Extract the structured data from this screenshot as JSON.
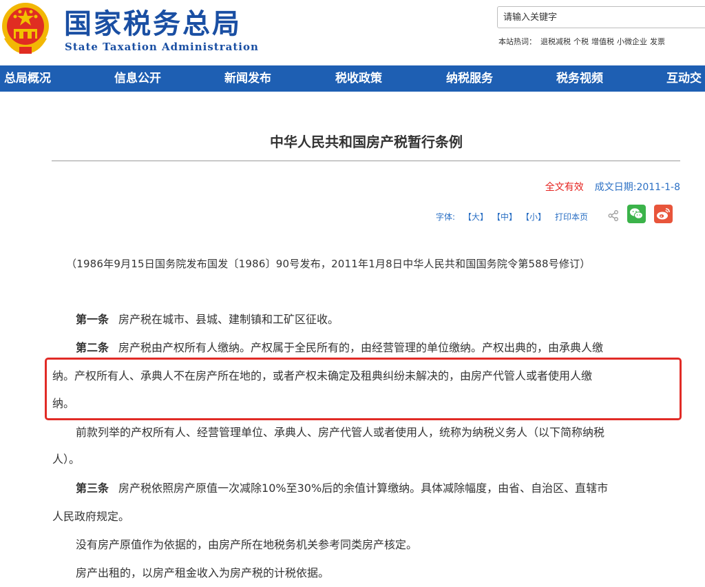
{
  "header": {
    "site_name_cn": "国家税务总局",
    "site_name_en": "State Taxation Administration"
  },
  "search": {
    "placeholder": "请输入关键字"
  },
  "hot_words": {
    "label": "本站热词：",
    "items": [
      "退税减税",
      "个税",
      "增值税",
      "小微企业",
      "发票"
    ]
  },
  "nav": {
    "items": [
      "总局概况",
      "信息公开",
      "新闻发布",
      "税收政策",
      "纳税服务",
      "税务视频",
      "互动交"
    ]
  },
  "article": {
    "title": "中华人民共和国房产税暂行条例",
    "validity": "全文有效",
    "date_label": "成文日期:2011-1-8",
    "font_label": "字体:",
    "font_large": "【大】",
    "font_medium": "【中】",
    "font_small": "【小】",
    "print_label": "打印本页",
    "source": "（1986年9月15日国务院发布国发〔1986〕90号发布，2011年1月8日中华人民共和国国务院令第588号修订）",
    "p1": {
      "no": "第一条",
      "text": "房产税在城市、县城、建制镇和工矿区征收。"
    },
    "p2": {
      "no": "第二条",
      "text": "房产税由产权所有人缴纳。产权属于全民所有的，由经营管理的单位缴纳。产权出典的，由承典人缴"
    },
    "p2_l2": "纳。产权所有人、承典人不在房产所在地的，或者产权未确定及租典纠纷未解决的，由房产代管人或者使用人缴",
    "p2_l3": "纳。",
    "p3_l1": "前款列举的产权所有人、经营管理单位、承典人、房产代管人或者使用人，统称为纳税义务人（以下简称纳税",
    "p3_l2": "人）。",
    "p4": {
      "no": "第三条",
      "text": "房产税依照房产原值一次减除10%至30%后的余值计算缴纳。具体减除幅度，由省、自治区、直辖市"
    },
    "p4_l2": "人民政府规定。",
    "p5": "没有房产原值作为依据的，由房产所在地税务机关参考同类房产核定。",
    "p6": "房产出租的，以房产租金收入为房产税的计税依据。"
  },
  "colors": {
    "brand_blue": "#1a4fa3",
    "nav_blue": "#1e5fb3",
    "link_blue": "#2a6fc4",
    "alert_red": "#e5231f",
    "highlight_red": "#e12b26",
    "wechat_green": "#3bb34a",
    "weibo_red": "#e8553b"
  },
  "icons": [
    "national-emblem-icon",
    "share-icon",
    "wechat-icon",
    "weibo-icon"
  ]
}
